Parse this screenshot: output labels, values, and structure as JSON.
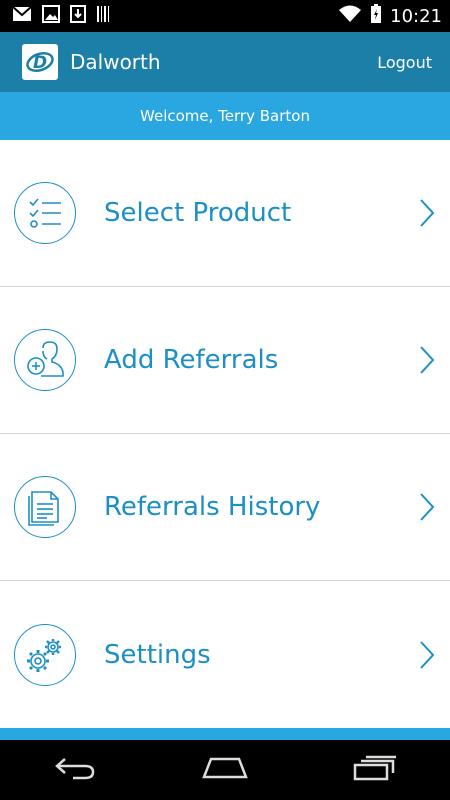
{
  "status_bar": {
    "time": "10:21",
    "icons": [
      "gmail-icon",
      "image-icon",
      "download-icon",
      "barcode-icon",
      "wifi-icon",
      "battery-charging-icon"
    ]
  },
  "app_bar": {
    "title": "Dalworth",
    "logo_letter": "D",
    "logout_label": "Logout"
  },
  "welcome": {
    "text": "Welcome, Terry Barton"
  },
  "menu": {
    "items": [
      {
        "label": "Select Product",
        "icon": "checklist-icon"
      },
      {
        "label": "Add Referrals",
        "icon": "add-user-icon"
      },
      {
        "label": "Referrals History",
        "icon": "document-icon"
      },
      {
        "label": "Settings",
        "icon": "gears-icon"
      }
    ]
  },
  "nav_bar": {
    "buttons": [
      "back-icon",
      "home-icon",
      "recent-apps-icon"
    ]
  },
  "colors": {
    "app_bar": "#1c7fa8",
    "accent": "#2aa7e0",
    "menu_text": "#1b8fc6"
  }
}
